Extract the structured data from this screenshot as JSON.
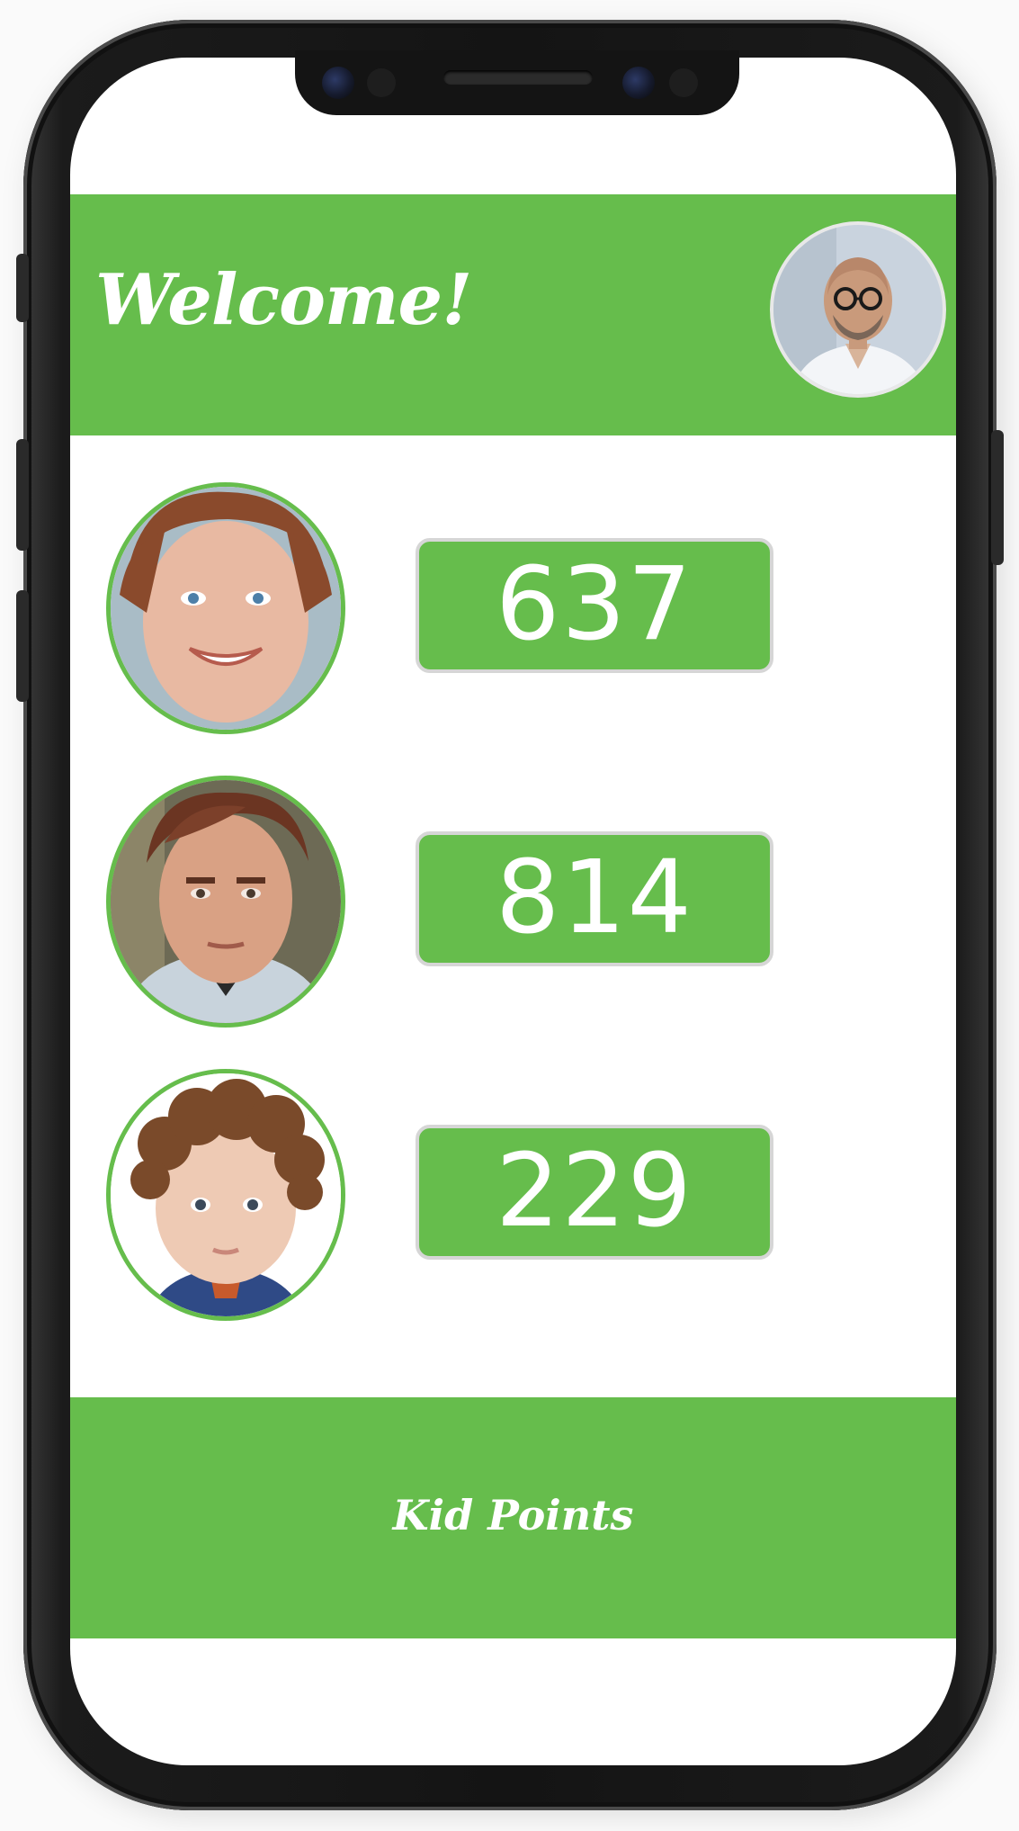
{
  "header": {
    "title": "Welcome!"
  },
  "colors": {
    "brand_green": "#66bd4c",
    "box_border": "#d6d6d6",
    "text": "#ffffff"
  },
  "kids": [
    {
      "points": "637"
    },
    {
      "points": "814"
    },
    {
      "points": "229"
    }
  ],
  "footer": {
    "label": "Kid Points"
  }
}
